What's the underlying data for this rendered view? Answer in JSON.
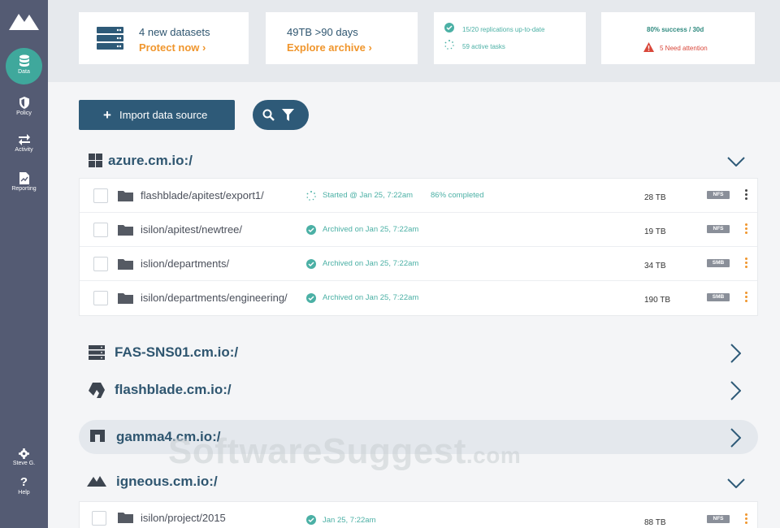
{
  "sidebar": {
    "items": [
      {
        "label": "Data",
        "icon": "database-icon",
        "active": true
      },
      {
        "label": "Policy",
        "icon": "shield-icon"
      },
      {
        "label": "Activity",
        "icon": "swap-arrows-icon"
      },
      {
        "label": "Reporting",
        "icon": "report-icon"
      }
    ],
    "bottom": [
      {
        "label": "Steve G.",
        "icon": "gear-icon"
      },
      {
        "label": "Help",
        "icon": "question-icon"
      }
    ]
  },
  "cards": {
    "datasets": {
      "title": "4 new datasets",
      "link": "Protect now ›"
    },
    "archive": {
      "title": "49TB >90 days",
      "link": "Explore archive ›"
    },
    "replication": {
      "line1": "15/20 replications up-to-date",
      "line2": "59 active tasks"
    },
    "success": {
      "line1": "80% success / 30d",
      "line2": "5 Need attention"
    }
  },
  "toolbar": {
    "import_label": "Import data source"
  },
  "hosts": [
    {
      "name": "azure.cm.io:/",
      "icon": "windows-icon",
      "expanded": true,
      "rows": [
        {
          "path": "flashblade/apitest/export1/",
          "status": "Started @ Jan 25, 7:22am",
          "progress": "86% completed",
          "size": "28 TB",
          "protocol": "NFS"
        },
        {
          "path": "isilon/apitest/newtree/",
          "status": "Archived on Jan 25, 7:22am",
          "size": "19 TB",
          "protocol": "NFS"
        },
        {
          "path": "islion/departments/",
          "status": "Archived on Jan 25, 7:22am",
          "size": "34 TB",
          "protocol": "SMB"
        },
        {
          "path": "isilon/departments/engineering/",
          "status": "Archived on Jan 25, 7:22am",
          "size": "190 TB",
          "protocol": "SMB"
        }
      ]
    },
    {
      "name": "FAS-SNS01.cm.io:/",
      "icon": "server-icon",
      "expanded": false
    },
    {
      "name": "flashblade.cm.io:/",
      "icon": "pure-storage-icon",
      "expanded": false
    },
    {
      "name": "gamma4.cm.io:/",
      "icon": "gateway-icon",
      "expanded": false
    },
    {
      "name": "igneous.cm.io:/",
      "icon": "mountain-icon",
      "expanded": true,
      "rows": [
        {
          "path": "isilon/project/2015",
          "status": "Jan 25, 7:22am",
          "size": "88 TB",
          "protocol": "NFS"
        }
      ]
    }
  ],
  "watermark": {
    "main": "SoftwareSuggest",
    "suffix": ".com"
  },
  "colors": {
    "sidebar": "#545b73",
    "accent": "#3fa89c",
    "primary": "#2e5a78",
    "warning": "#f0962d",
    "danger": "#d9473a"
  }
}
